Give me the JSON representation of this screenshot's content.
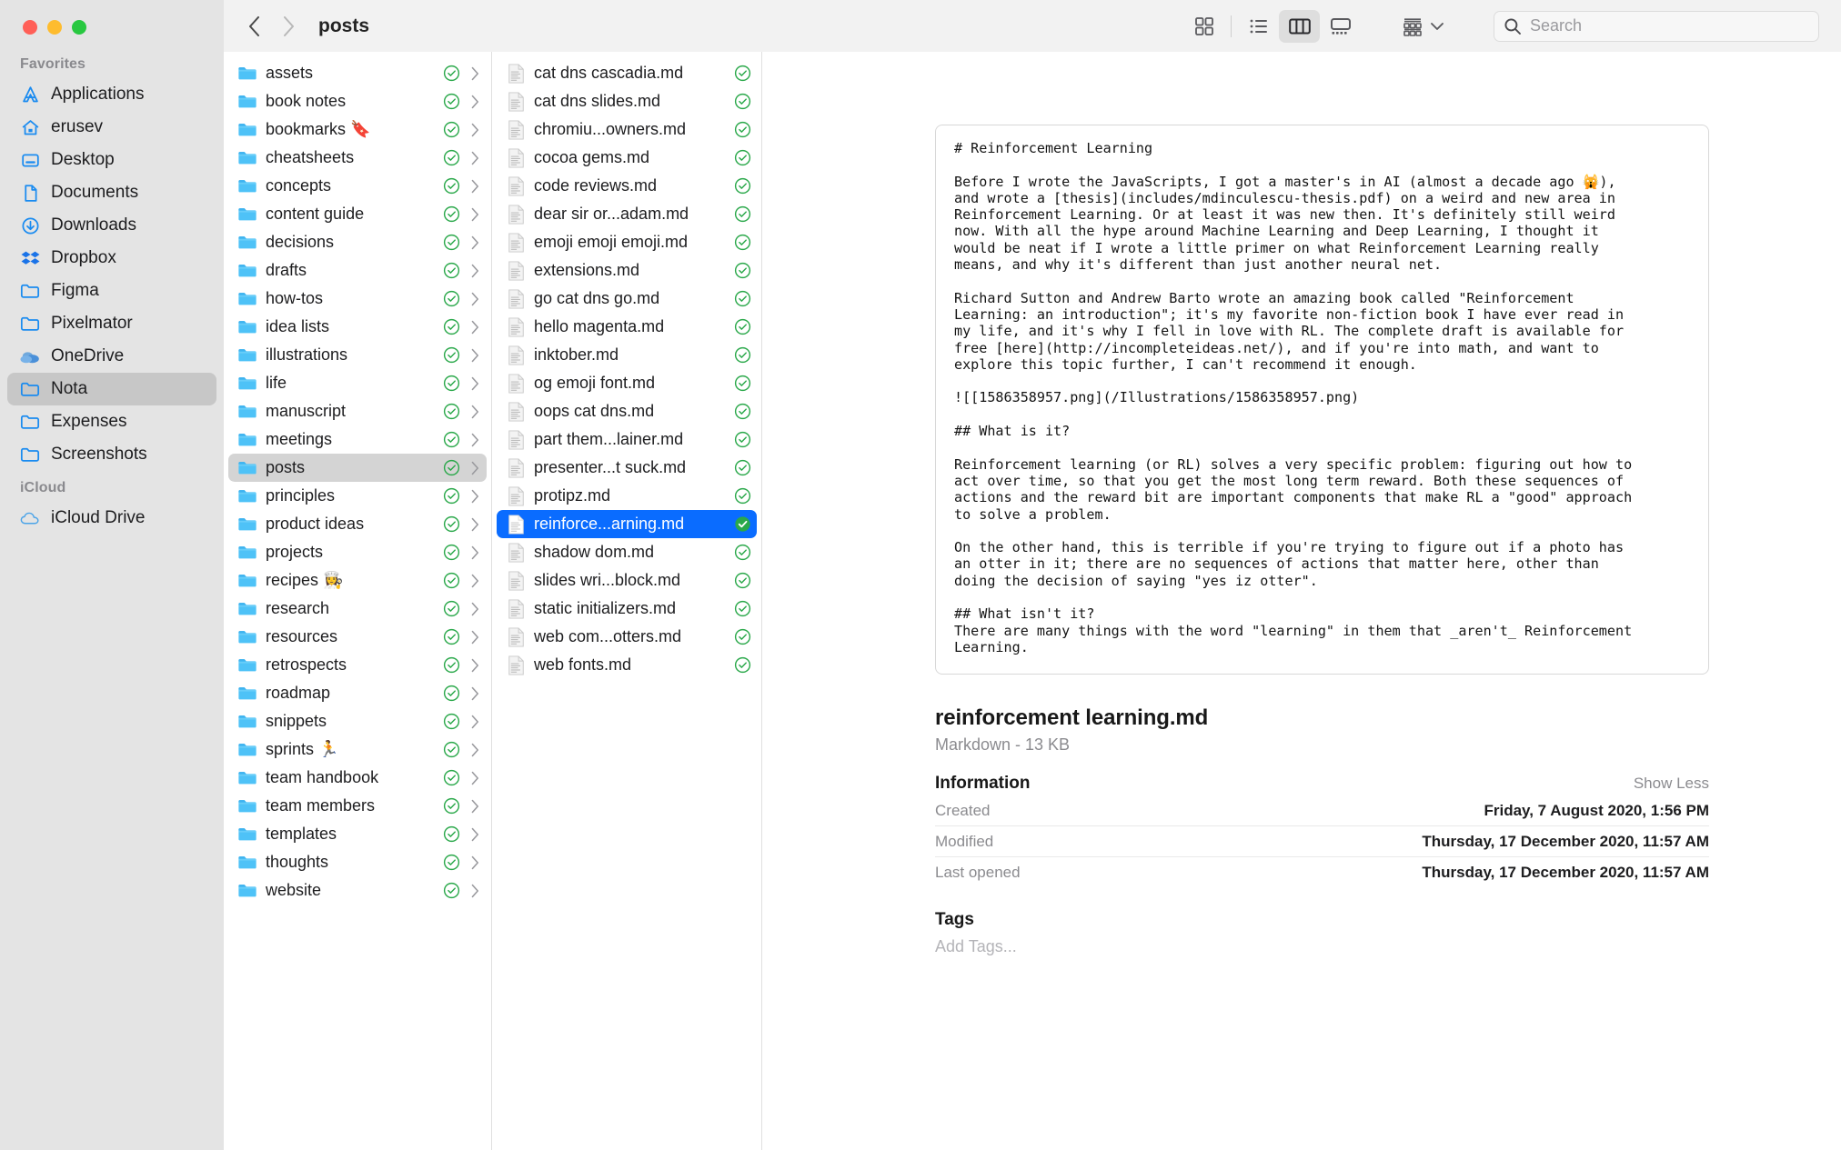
{
  "window": {
    "traffic_lights": [
      "close",
      "minimize",
      "zoom"
    ],
    "colors": {
      "close": "#ff5f57",
      "minimize": "#febc2e",
      "zoom": "#28c840",
      "accent_selection": "#0a6cff",
      "icloud_green": "#34a853",
      "sidebar_bg": "#e4e4e4",
      "toolbar_bg": "#f2f2f2"
    }
  },
  "toolbar": {
    "back_label": "Back",
    "forward_label": "Forward",
    "breadcrumb": "posts",
    "view_buttons": [
      {
        "name": "icon-view",
        "label": "as Icons",
        "active": false
      },
      {
        "name": "list-view",
        "label": "as List",
        "active": false
      },
      {
        "name": "column-view",
        "label": "as Columns",
        "active": true
      },
      {
        "name": "gallery-view",
        "label": "as Gallery",
        "active": false
      }
    ],
    "group_button_label": "Group",
    "search": {
      "placeholder": "Search",
      "value": ""
    }
  },
  "sidebar": {
    "sections": [
      {
        "title": "Favorites",
        "items": [
          {
            "label": "Applications",
            "icon": "applications-icon",
            "selected": false
          },
          {
            "label": "erusev",
            "icon": "home-icon",
            "selected": false
          },
          {
            "label": "Desktop",
            "icon": "desktop-icon",
            "selected": false
          },
          {
            "label": "Documents",
            "icon": "document-icon",
            "selected": false
          },
          {
            "label": "Downloads",
            "icon": "downloads-icon",
            "selected": false
          },
          {
            "label": "Dropbox",
            "icon": "dropbox-icon",
            "selected": false
          },
          {
            "label": "Figma",
            "icon": "folder-icon",
            "selected": false
          },
          {
            "label": "Pixelmator",
            "icon": "folder-icon",
            "selected": false
          },
          {
            "label": "OneDrive",
            "icon": "onedrive-icon",
            "selected": false
          },
          {
            "label": "Nota",
            "icon": "folder-icon",
            "selected": true
          },
          {
            "label": "Expenses",
            "icon": "folder-icon",
            "selected": false
          },
          {
            "label": "Screenshots",
            "icon": "folder-icon",
            "selected": false
          }
        ]
      },
      {
        "title": "iCloud",
        "items": [
          {
            "label": "iCloud Drive",
            "icon": "cloud-icon",
            "selected": false
          }
        ]
      }
    ]
  },
  "columns": {
    "folders": [
      {
        "label": "assets",
        "synced": true,
        "selected": false
      },
      {
        "label": "book notes",
        "synced": true,
        "selected": false
      },
      {
        "label": "bookmarks 🔖",
        "synced": true,
        "selected": false
      },
      {
        "label": "cheatsheets",
        "synced": true,
        "selected": false
      },
      {
        "label": "concepts",
        "synced": true,
        "selected": false
      },
      {
        "label": "content guide",
        "synced": true,
        "selected": false
      },
      {
        "label": "decisions",
        "synced": true,
        "selected": false
      },
      {
        "label": "drafts",
        "synced": true,
        "selected": false
      },
      {
        "label": "how-tos",
        "synced": true,
        "selected": false
      },
      {
        "label": "idea lists",
        "synced": true,
        "selected": false
      },
      {
        "label": "illustrations",
        "synced": true,
        "selected": false
      },
      {
        "label": "life",
        "synced": true,
        "selected": false
      },
      {
        "label": "manuscript",
        "synced": true,
        "selected": false
      },
      {
        "label": "meetings",
        "synced": true,
        "selected": false
      },
      {
        "label": "posts",
        "synced": true,
        "selected": true
      },
      {
        "label": "principles",
        "synced": true,
        "selected": false
      },
      {
        "label": "product ideas",
        "synced": true,
        "selected": false
      },
      {
        "label": "projects",
        "synced": true,
        "selected": false
      },
      {
        "label": "recipes 👩‍🍳",
        "synced": true,
        "selected": false
      },
      {
        "label": "research",
        "synced": true,
        "selected": false
      },
      {
        "label": "resources",
        "synced": true,
        "selected": false
      },
      {
        "label": "retrospects",
        "synced": true,
        "selected": false
      },
      {
        "label": "roadmap",
        "synced": true,
        "selected": false
      },
      {
        "label": "snippets",
        "synced": true,
        "selected": false
      },
      {
        "label": "sprints 🏃",
        "synced": true,
        "selected": false
      },
      {
        "label": "team handbook",
        "synced": true,
        "selected": false
      },
      {
        "label": "team members",
        "synced": true,
        "selected": false
      },
      {
        "label": "templates",
        "synced": true,
        "selected": false
      },
      {
        "label": "thoughts",
        "synced": true,
        "selected": false
      },
      {
        "label": "website",
        "synced": true,
        "selected": false
      }
    ],
    "files": [
      {
        "label": "cat dns cascadia.md",
        "synced": true,
        "selected": false
      },
      {
        "label": "cat dns slides.md",
        "synced": true,
        "selected": false
      },
      {
        "label": "chromiu...owners.md",
        "synced": true,
        "selected": false
      },
      {
        "label": "cocoa gems.md",
        "synced": true,
        "selected": false
      },
      {
        "label": "code reviews.md",
        "synced": true,
        "selected": false
      },
      {
        "label": "dear sir or...adam.md",
        "synced": true,
        "selected": false
      },
      {
        "label": "emoji emoji emoji.md",
        "synced": true,
        "selected": false
      },
      {
        "label": "extensions.md",
        "synced": true,
        "selected": false
      },
      {
        "label": "go cat dns go.md",
        "synced": true,
        "selected": false
      },
      {
        "label": "hello magenta.md",
        "synced": true,
        "selected": false
      },
      {
        "label": "inktober.md",
        "synced": true,
        "selected": false
      },
      {
        "label": "og emoji font.md",
        "synced": true,
        "selected": false
      },
      {
        "label": "oops cat dns.md",
        "synced": true,
        "selected": false
      },
      {
        "label": "part them...lainer.md",
        "synced": true,
        "selected": false
      },
      {
        "label": "presenter...t suck.md",
        "synced": true,
        "selected": false
      },
      {
        "label": "protipz.md",
        "synced": true,
        "selected": false
      },
      {
        "label": "reinforce...arning.md",
        "synced": true,
        "selected": true
      },
      {
        "label": "shadow dom.md",
        "synced": true,
        "selected": false
      },
      {
        "label": "slides wri...block.md",
        "synced": true,
        "selected": false
      },
      {
        "label": "static initializers.md",
        "synced": true,
        "selected": false
      },
      {
        "label": "web com...otters.md",
        "synced": true,
        "selected": false
      },
      {
        "label": "web fonts.md",
        "synced": true,
        "selected": false
      }
    ]
  },
  "preview": {
    "text": "# Reinforcement Learning\n\nBefore I wrote the JavaScripts, I got a master's in AI (almost a decade ago 🙀),\nand wrote a [thesis](includes/mdinculescu-thesis.pdf) on a weird and new area in\nReinforcement Learning. Or at least it was new then. It's definitely still weird\nnow. With all the hype around Machine Learning and Deep Learning, I thought it\nwould be neat if I wrote a little primer on what Reinforcement Learning really\nmeans, and why it's different than just another neural net.\n\nRichard Sutton and Andrew Barto wrote an amazing book called \"Reinforcement\nLearning: an introduction\"; it's my favorite non-fiction book I have ever read in\nmy life, and it's why I fell in love with RL. The complete draft is available for\nfree [here](http://incompleteideas.net/), and if you're into math, and want to\nexplore this topic further, I can't recommend it enough.\n\n![[1586358957.png](/Illustrations/1586358957.png)\n\n## What is it?\n\nReinforcement learning (or RL) solves a very specific problem: figuring out how to\nact over time, so that you get the most long term reward. Both these sequences of\nactions and the reward bit are important components that make RL a \"good\" approach\nto solve a problem.\n\nOn the other hand, this is terrible if you're trying to figure out if a photo has\nan otter in it; there are no sequences of actions that matter here, other than\ndoing the decision of saying \"yes iz otter\".\n\n## What isn't it?\nThere are many things with the word \"learning\" in them that _aren't_ Reinforcement\nLearning."
  },
  "info": {
    "file_name": "reinforcement learning.md",
    "kind_and_size": "Markdown - 13 KB",
    "information_title": "Information",
    "show_less_label": "Show Less",
    "rows": [
      {
        "key": "Created",
        "value": "Friday, 7 August 2020, 1:56 PM"
      },
      {
        "key": "Modified",
        "value": "Thursday, 17 December 2020, 11:57 AM"
      },
      {
        "key": "Last opened",
        "value": "Thursday, 17 December 2020, 11:57 AM"
      }
    ],
    "tags_title": "Tags",
    "tags_placeholder": "Add Tags..."
  }
}
